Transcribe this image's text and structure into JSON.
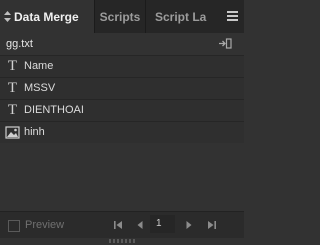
{
  "tabs": {
    "data_merge": "Data Merge",
    "scripts": "Scripts",
    "script_label": "Script La"
  },
  "source": {
    "filename": "gg.txt"
  },
  "fields": [
    {
      "label": "Name",
      "icon": "text-field-icon"
    },
    {
      "label": "MSSV",
      "icon": "text-field-icon"
    },
    {
      "label": "DIENTHOAI",
      "icon": "text-field-icon"
    },
    {
      "label": "hinh",
      "icon": "image-field-icon"
    }
  ],
  "footer": {
    "preview_label": "Preview",
    "preview_checked": false,
    "current_record": "1"
  }
}
